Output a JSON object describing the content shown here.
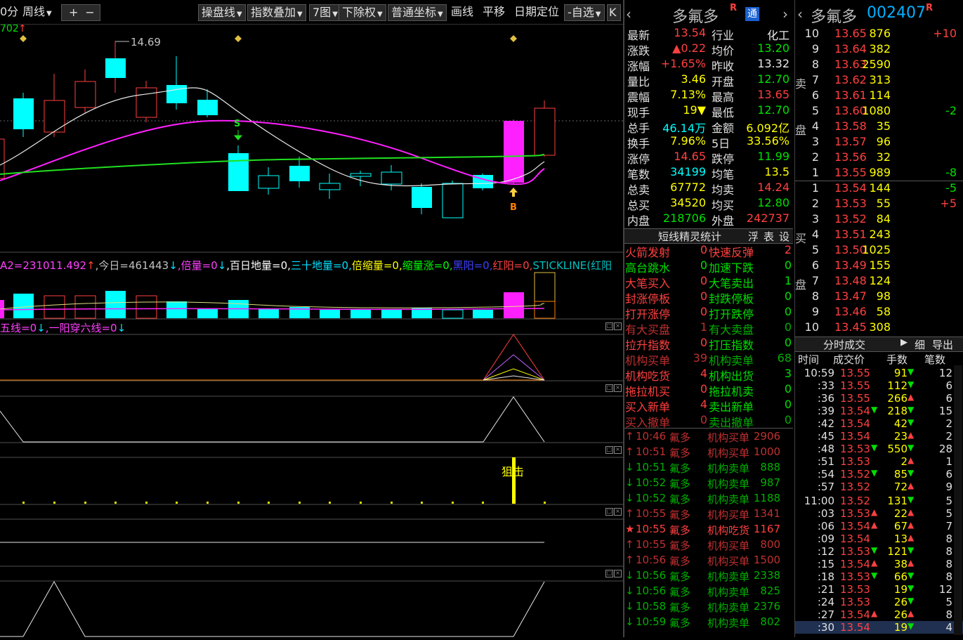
{
  "toolbar": {
    "period_partial": "0分",
    "week": "周线",
    "plus": "+",
    "minus": "−",
    "ops_line": "操盘线",
    "index_overlay": "指数叠加",
    "seven_charts": "7图",
    "ex_rights": "下除权",
    "coord": "普通坐标",
    "draw": "画线",
    "pan": "平移",
    "date_locate": "日期定位",
    "watchlist": "自选",
    "collapse": "K"
  },
  "chart": {
    "top_left_code": "702",
    "high_label": "14.69",
    "marker_s": "S",
    "marker_b": "B",
    "vol_formula": [
      {
        "text": "A2=231011.492",
        "color": "#ff40ff"
      },
      {
        "text": "↑",
        "color": "#ff4040"
      },
      {
        "text": ",今日=461443",
        "color": "#c0c0c0"
      },
      {
        "text": "↓",
        "color": "#00e0ff"
      },
      {
        "text": ",倍量=0",
        "color": "#ff40ff"
      },
      {
        "text": "↓",
        "color": "#00e0ff"
      },
      {
        "text": ",百日地量=0,",
        "color": "#ffffff"
      },
      {
        "text": "三十地量=0,",
        "color": "#00e0ff"
      },
      {
        "text": "倍缩量=0,",
        "color": "#ffff00"
      },
      {
        "text": "缩量涨=0,",
        "color": "#00ff00"
      },
      {
        "text": "黑阳=0,",
        "color": "#4040ff"
      },
      {
        "text": "红阳=0,",
        "color": "#ff4040"
      },
      {
        "text": "STICKLINE(红阳",
        "color": "#00c0c0"
      }
    ],
    "indicator_formula": [
      {
        "text": "五线=0",
        "color": "#ff40ff"
      },
      {
        "text": "↓",
        "color": "#00e0ff"
      },
      {
        "text": ",一阳穿六线=0",
        "color": "#ff40ff"
      },
      {
        "text": "↓",
        "color": "#00e0ff"
      }
    ],
    "snipe_label": "狙击"
  },
  "quote": {
    "name": "多氟多",
    "badge_r": "R",
    "badge_tong": "通",
    "rows": [
      {
        "l1": "最新",
        "v1": "13.54",
        "c1": "red",
        "l2": "行业",
        "v2": "化工",
        "c2": "white"
      },
      {
        "l1": "涨跌",
        "v1": "▲0.22",
        "c1": "red",
        "l2": "均价",
        "v2": "13.20",
        "c2": "green"
      },
      {
        "l1": "涨幅",
        "v1": "+1.65%",
        "c1": "red",
        "l2": "昨收",
        "v2": "13.32",
        "c2": "white"
      },
      {
        "l1": "量比",
        "v1": "3.46",
        "c1": "yellow",
        "l2": "开盘",
        "v2": "12.70",
        "c2": "green"
      },
      {
        "l1": "震幅",
        "v1": "7.13%",
        "c1": "yellow",
        "l2": "最高",
        "v2": "13.65",
        "c2": "red"
      },
      {
        "l1": "现手",
        "v1": "19▼",
        "c1": "yellow",
        "l2": "最低",
        "v2": "12.70",
        "c2": "green"
      },
      {
        "l1": "总手",
        "v1": "46.14万",
        "c1": "cyan",
        "l2": "金额",
        "v2": "6.092亿",
        "c2": "yellow"
      },
      {
        "l1": "换手",
        "v1": "7.96%",
        "c1": "yellow",
        "l2": "5日",
        "v2": "33.56%",
        "c2": "yellow"
      },
      {
        "l1": "涨停",
        "v1": "14.65",
        "c1": "red",
        "l2": "跌停",
        "v2": "11.99",
        "c2": "green"
      },
      {
        "l1": "笔数",
        "v1": "34199",
        "c1": "cyan",
        "l2": "均笔",
        "v2": "13.5",
        "c2": "yellow"
      },
      {
        "l1": "总卖",
        "v1": "67772",
        "c1": "yellow",
        "l2": "均卖",
        "v2": "14.24",
        "c2": "red"
      },
      {
        "l1": "总买",
        "v1": "34520",
        "c1": "yellow",
        "l2": "均买",
        "v2": "12.80",
        "c2": "green"
      },
      {
        "l1": "内盘",
        "v1": "218706",
        "c1": "green",
        "l2": "外盘",
        "v2": "242737",
        "c2": "red"
      }
    ],
    "spirit_title": "短线精灵统计",
    "spirit_buttons": [
      "浮",
      "表",
      "设"
    ],
    "spirit_rows": [
      {
        "a": "火箭发射",
        "av": "0",
        "ac": "red",
        "b": "快速反弹",
        "bv": "2",
        "bc": "red"
      },
      {
        "a": "高台跳水",
        "av": "0",
        "ac": "green",
        "b": "加速下跌",
        "bv": "0",
        "bc": "green"
      },
      {
        "a": "大笔买入",
        "av": "0",
        "ac": "red",
        "b": "大笔卖出",
        "bv": "1",
        "bc": "green"
      },
      {
        "a": "封涨停板",
        "av": "0",
        "ac": "red",
        "b": "封跌停板",
        "bv": "0",
        "bc": "green"
      },
      {
        "a": "打开涨停",
        "av": "0",
        "ac": "red",
        "b": "打开跌停",
        "bv": "0",
        "bc": "green"
      },
      {
        "a": "有大买盘",
        "av": "1",
        "ac": "dred",
        "b": "有大卖盘",
        "bv": "0",
        "bc": "dgreen"
      },
      {
        "a": "拉升指数",
        "av": "0",
        "ac": "red",
        "b": "打压指数",
        "bv": "0",
        "bc": "green"
      },
      {
        "a": "机构买单",
        "av": "39",
        "ac": "dred",
        "b": "机构卖单",
        "bv": "68",
        "bc": "dgreen"
      },
      {
        "a": "机构吃货",
        "av": "4",
        "ac": "red",
        "b": "机构出货",
        "bv": "3",
        "bc": "green"
      },
      {
        "a": "拖拉机买",
        "av": "0",
        "ac": "red",
        "b": "拖拉机卖",
        "bv": "0",
        "bc": "green"
      },
      {
        "a": "买入新单",
        "av": "4",
        "ac": "red",
        "b": "卖出新单",
        "bv": "0",
        "bc": "green"
      },
      {
        "a": "买入撤单",
        "av": "0",
        "ac": "dred",
        "b": "卖出撤单",
        "bv": "0",
        "bc": "dgreen"
      }
    ],
    "events": [
      {
        "dir": "↑",
        "time": "10:46",
        "stock": "氟多",
        "type": "机构买单",
        "vol": "2906",
        "color": "dred"
      },
      {
        "dir": "↑",
        "time": "10:51",
        "stock": "氟多",
        "type": "机构买单",
        "vol": "1000",
        "color": "dred"
      },
      {
        "dir": "↓",
        "time": "10:51",
        "stock": "氟多",
        "type": "机构卖单",
        "vol": "888",
        "color": "dgreen"
      },
      {
        "dir": "↓",
        "time": "10:52",
        "stock": "氟多",
        "type": "机构卖单",
        "vol": "987",
        "color": "dgreen"
      },
      {
        "dir": "↓",
        "time": "10:52",
        "stock": "氟多",
        "type": "机构卖单",
        "vol": "1188",
        "color": "dgreen"
      },
      {
        "dir": "↑",
        "time": "10:55",
        "stock": "氟多",
        "type": "机构买单",
        "vol": "1341",
        "color": "dred"
      },
      {
        "dir": "★",
        "time": "10:55",
        "stock": "氟多",
        "type": "机构吃货",
        "vol": "1167",
        "color": "red"
      },
      {
        "dir": "↑",
        "time": "10:55",
        "stock": "氟多",
        "type": "机构买单",
        "vol": "800",
        "color": "dred"
      },
      {
        "dir": "↑",
        "time": "10:56",
        "stock": "氟多",
        "type": "机构买单",
        "vol": "1500",
        "color": "dred"
      },
      {
        "dir": "↓",
        "time": "10:56",
        "stock": "氟多",
        "type": "机构卖单",
        "vol": "2338",
        "color": "dgreen"
      },
      {
        "dir": "↓",
        "time": "10:56",
        "stock": "氟多",
        "type": "机构卖单",
        "vol": "825",
        "color": "dgreen"
      },
      {
        "dir": "↓",
        "time": "10:58",
        "stock": "氟多",
        "type": "机构卖单",
        "vol": "2376",
        "color": "dgreen"
      },
      {
        "dir": "↓",
        "time": "10:59",
        "stock": "氟多",
        "type": "机构卖单",
        "vol": "802",
        "color": "dgreen"
      }
    ]
  },
  "book": {
    "name": "多氟多",
    "code": "002407",
    "badge_r": "R",
    "sell_label": [
      "卖",
      "盘"
    ],
    "buy_label": [
      "买",
      "盘"
    ],
    "sells": [
      {
        "lvl": "10",
        "price": "13.65",
        "vol": "876",
        "chg": "+10",
        "cc": "red"
      },
      {
        "lvl": "9",
        "price": "13.64",
        "vol": "382",
        "chg": "",
        "cc": "red"
      },
      {
        "lvl": "8",
        "price": "13.63",
        "vol": "2590",
        "chg": "",
        "cc": "red"
      },
      {
        "lvl": "7",
        "price": "13.62",
        "vol": "313",
        "chg": "",
        "cc": "red"
      },
      {
        "lvl": "6",
        "price": "13.61",
        "vol": "114",
        "chg": "",
        "cc": "red"
      },
      {
        "lvl": "5",
        "price": "13.60",
        "vol": "1080",
        "chg": "-2",
        "cc": "green"
      },
      {
        "lvl": "4",
        "price": "13.58",
        "vol": "35",
        "chg": "",
        "cc": "red"
      },
      {
        "lvl": "3",
        "price": "13.57",
        "vol": "96",
        "chg": "",
        "cc": "red"
      },
      {
        "lvl": "2",
        "price": "13.56",
        "vol": "32",
        "chg": "",
        "cc": "red"
      },
      {
        "lvl": "1",
        "price": "13.55",
        "vol": "989",
        "chg": "-8",
        "cc": "green"
      }
    ],
    "buys": [
      {
        "lvl": "1",
        "price": "13.54",
        "vol": "144",
        "chg": "-5",
        "cc": "green"
      },
      {
        "lvl": "2",
        "price": "13.53",
        "vol": "55",
        "chg": "+5",
        "cc": "red"
      },
      {
        "lvl": "3",
        "price": "13.52",
        "vol": "84",
        "chg": "",
        "cc": "red"
      },
      {
        "lvl": "4",
        "price": "13.51",
        "vol": "243",
        "chg": "",
        "cc": "red"
      },
      {
        "lvl": "5",
        "price": "13.50",
        "vol": "1025",
        "chg": "",
        "cc": "red"
      },
      {
        "lvl": "6",
        "price": "13.49",
        "vol": "155",
        "chg": "",
        "cc": "red"
      },
      {
        "lvl": "7",
        "price": "13.48",
        "vol": "124",
        "chg": "",
        "cc": "red"
      },
      {
        "lvl": "8",
        "price": "13.47",
        "vol": "98",
        "chg": "",
        "cc": "red"
      },
      {
        "lvl": "9",
        "price": "13.46",
        "vol": "58",
        "chg": "",
        "cc": "red"
      },
      {
        "lvl": "10",
        "price": "13.45",
        "vol": "308",
        "chg": "",
        "cc": "red"
      }
    ],
    "trades_title": "分时成交",
    "trades_buttons": [
      "▶",
      "细",
      "导出"
    ],
    "trades_headers": [
      "时间",
      "成交价",
      "手数",
      "笔数"
    ],
    "trades": [
      {
        "t": "10:59",
        "p": "13.55",
        "pa": "",
        "v": "91",
        "va": "▼",
        "vc": "yellow",
        "n": "12"
      },
      {
        "t": ":33",
        "p": "13.55",
        "pa": "",
        "v": "112",
        "va": "▼",
        "vc": "yellow",
        "n": "6"
      },
      {
        "t": ":36",
        "p": "13.55",
        "pa": "",
        "v": "266",
        "va": "▲",
        "vc": "yellow",
        "n": "6"
      },
      {
        "t": ":39",
        "p": "13.54",
        "pa": "▼",
        "v": "218",
        "va": "▼",
        "vc": "yellow",
        "n": "15"
      },
      {
        "t": ":42",
        "p": "13.54",
        "pa": "",
        "v": "42",
        "va": "▼",
        "vc": "yellow",
        "n": "2"
      },
      {
        "t": ":45",
        "p": "13.54",
        "pa": "",
        "v": "23",
        "va": "▲",
        "vc": "yellow",
        "n": "2"
      },
      {
        "t": ":48",
        "p": "13.53",
        "pa": "▼",
        "v": "550",
        "va": "▼",
        "vc": "yellow",
        "n": "28"
      },
      {
        "t": ":51",
        "p": "13.53",
        "pa": "",
        "v": "2",
        "va": "▲",
        "vc": "yellow",
        "n": "1"
      },
      {
        "t": ":54",
        "p": "13.52",
        "pa": "▼",
        "v": "85",
        "va": "▼",
        "vc": "yellow",
        "n": "6"
      },
      {
        "t": ":57",
        "p": "13.52",
        "pa": "",
        "v": "72",
        "va": "▲",
        "vc": "yellow",
        "n": "9"
      },
      {
        "t": "11:00",
        "p": "13.52",
        "pa": "",
        "v": "131",
        "va": "▼",
        "vc": "yellow",
        "n": "5"
      },
      {
        "t": ":03",
        "p": "13.53",
        "pa": "▲",
        "v": "22",
        "va": "▲",
        "vc": "yellow",
        "n": "5"
      },
      {
        "t": ":06",
        "p": "13.54",
        "pa": "▲",
        "v": "67",
        "va": "▲",
        "vc": "yellow",
        "n": "7"
      },
      {
        "t": ":09",
        "p": "13.54",
        "pa": "",
        "v": "13",
        "va": "▲",
        "vc": "yellow",
        "n": "8"
      },
      {
        "t": ":12",
        "p": "13.53",
        "pa": "▼",
        "v": "121",
        "va": "▼",
        "vc": "yellow",
        "n": "8"
      },
      {
        "t": ":15",
        "p": "13.54",
        "pa": "▲",
        "v": "38",
        "va": "▲",
        "vc": "yellow",
        "n": "8"
      },
      {
        "t": ":18",
        "p": "13.53",
        "pa": "▼",
        "v": "66",
        "va": "▼",
        "vc": "yellow",
        "n": "8"
      },
      {
        "t": ":21",
        "p": "13.53",
        "pa": "",
        "v": "19",
        "va": "▼",
        "vc": "yellow",
        "n": "12"
      },
      {
        "t": ":24",
        "p": "13.53",
        "pa": "",
        "v": "26",
        "va": "▼",
        "vc": "yellow",
        "n": "5"
      },
      {
        "t": ":27",
        "p": "13.54",
        "pa": "▲",
        "v": "26",
        "va": "▲",
        "vc": "yellow",
        "n": "8"
      },
      {
        "t": ":30",
        "p": "13.54",
        "pa": "",
        "v": "19",
        "va": "▼",
        "vc": "yellow",
        "n": "4"
      }
    ]
  },
  "colors": {
    "up": "#ff4040",
    "down": "#00ffff",
    "ma_white": "#e8e8e8",
    "ma_magenta": "#ff20ff",
    "ma_green": "#20e020"
  }
}
